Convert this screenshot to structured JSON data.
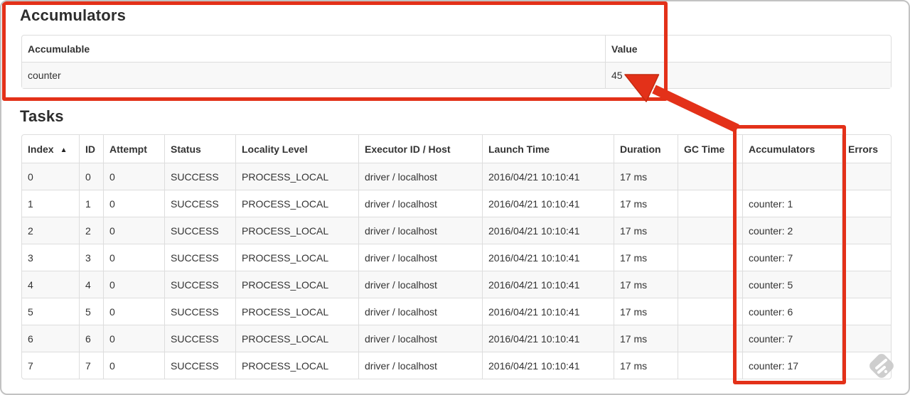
{
  "annotation_color": "#e33119",
  "accumulators": {
    "heading": "Accumulators",
    "columns": [
      "Accumulable",
      "Value"
    ],
    "rows": [
      [
        "counter",
        "45"
      ]
    ]
  },
  "tasks": {
    "heading": "Tasks",
    "sort_column": "Index",
    "sort_indicator": "▲",
    "columns": [
      "Index",
      "ID",
      "Attempt",
      "Status",
      "Locality Level",
      "Executor ID / Host",
      "Launch Time",
      "Duration",
      "GC Time",
      "Accumulators",
      "Errors"
    ],
    "rows": [
      [
        "0",
        "0",
        "0",
        "SUCCESS",
        "PROCESS_LOCAL",
        "driver / localhost",
        "2016/04/21 10:10:41",
        "17 ms",
        "",
        "",
        ""
      ],
      [
        "1",
        "1",
        "0",
        "SUCCESS",
        "PROCESS_LOCAL",
        "driver / localhost",
        "2016/04/21 10:10:41",
        "17 ms",
        "",
        "counter: 1",
        ""
      ],
      [
        "2",
        "2",
        "0",
        "SUCCESS",
        "PROCESS_LOCAL",
        "driver / localhost",
        "2016/04/21 10:10:41",
        "17 ms",
        "",
        "counter: 2",
        ""
      ],
      [
        "3",
        "3",
        "0",
        "SUCCESS",
        "PROCESS_LOCAL",
        "driver / localhost",
        "2016/04/21 10:10:41",
        "17 ms",
        "",
        "counter: 7",
        ""
      ],
      [
        "4",
        "4",
        "0",
        "SUCCESS",
        "PROCESS_LOCAL",
        "driver / localhost",
        "2016/04/21 10:10:41",
        "17 ms",
        "",
        "counter: 5",
        ""
      ],
      [
        "5",
        "5",
        "0",
        "SUCCESS",
        "PROCESS_LOCAL",
        "driver / localhost",
        "2016/04/21 10:10:41",
        "17 ms",
        "",
        "counter: 6",
        ""
      ],
      [
        "6",
        "6",
        "0",
        "SUCCESS",
        "PROCESS_LOCAL",
        "driver / localhost",
        "2016/04/21 10:10:41",
        "17 ms",
        "",
        "counter: 7",
        ""
      ],
      [
        "7",
        "7",
        "0",
        "SUCCESS",
        "PROCESS_LOCAL",
        "driver / localhost",
        "2016/04/21 10:10:41",
        "17 ms",
        "",
        "counter: 17",
        ""
      ]
    ]
  }
}
